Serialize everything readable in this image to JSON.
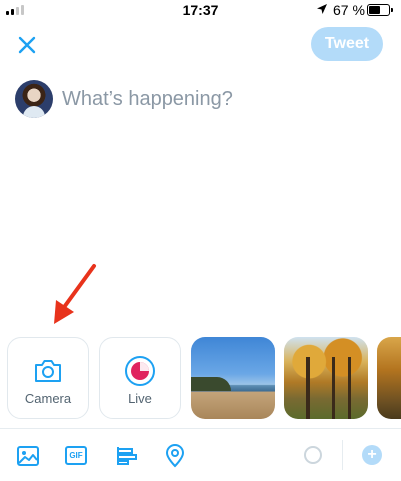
{
  "status_bar": {
    "time": "17:37",
    "battery_text": "67 %",
    "battery_level": 0.67,
    "signal_bars_active": 2,
    "signal_bars_total": 4
  },
  "header": {
    "close_icon": "close-icon",
    "tweet_label": "Tweet",
    "accent_color": "#1da1f2",
    "tweet_button_color": "#b3dbf9"
  },
  "compose": {
    "placeholder": "What’s happening?",
    "value": ""
  },
  "media_row": {
    "camera_label": "Camera",
    "live_label": "Live",
    "live_color": "#e0245e"
  },
  "toolbar": {
    "items": [
      "image-icon",
      "gif-icon",
      "poll-icon",
      "location-icon"
    ],
    "gif_label": "GIF",
    "add_label": "+"
  }
}
